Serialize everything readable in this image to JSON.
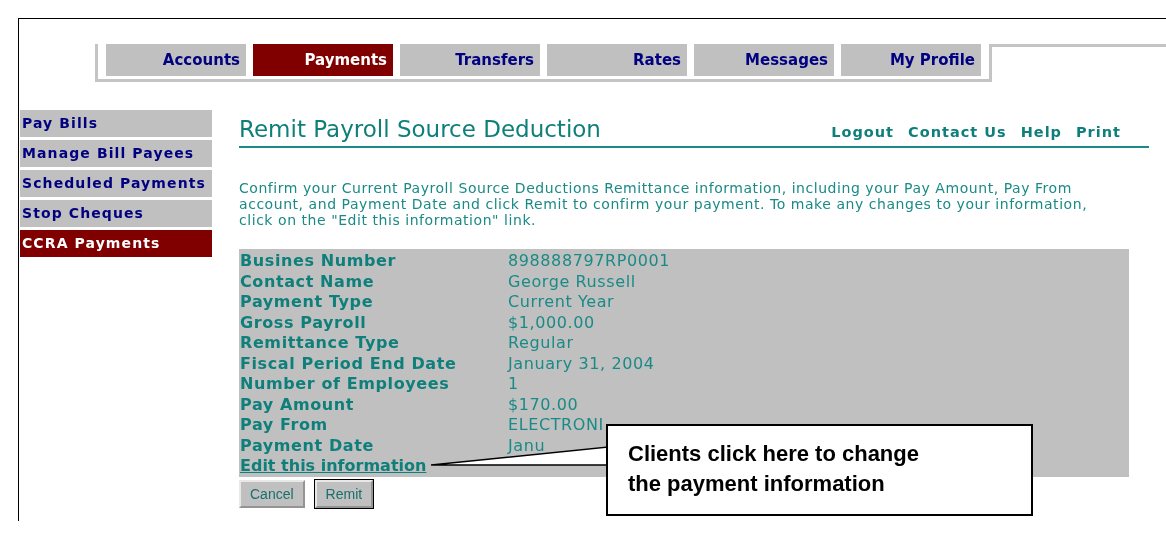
{
  "tabs": [
    {
      "label": "Accounts",
      "selected": false
    },
    {
      "label": "Payments",
      "selected": true
    },
    {
      "label": "Transfers",
      "selected": false
    },
    {
      "label": "Rates",
      "selected": false
    },
    {
      "label": "Messages",
      "selected": false
    },
    {
      "label": "My Profile",
      "selected": false
    }
  ],
  "sidebar": {
    "items": [
      {
        "label": "Pay Bills",
        "selected": false
      },
      {
        "label": "Manage Bill Payees",
        "selected": false
      },
      {
        "label": "Scheduled Payments",
        "selected": false
      },
      {
        "label": "Stop Cheques",
        "selected": false
      },
      {
        "label": "CCRA Payments",
        "selected": true
      }
    ]
  },
  "page_title": "Remit Payroll Source Deduction",
  "header_links": [
    "Logout",
    "Contact Us",
    "Help",
    "Print"
  ],
  "intro": "Confirm your Current Payroll Source Deductions Remittance information, including your Pay Amount, Pay From account, and Payment Date and click Remit to confirm your payment. To make any changes to your information, click on the \"Edit this information\" link.",
  "details": [
    {
      "label": "Busines Number",
      "value": "898888797RP0001"
    },
    {
      "label": "Contact Name",
      "value": "George Russell"
    },
    {
      "label": "Payment Type",
      "value": "Current Year"
    },
    {
      "label": "Gross Payroll",
      "value": "$1,000.00"
    },
    {
      "label": "Remittance Type",
      "value": "Regular"
    },
    {
      "label": "Fiscal Period End Date",
      "value": "January 31, 2004"
    },
    {
      "label": "Number of Employees",
      "value": "1"
    },
    {
      "label": "Pay Amount",
      "value": "$170.00"
    },
    {
      "label": "Pay From",
      "value": "ELECTRONI"
    },
    {
      "label": "Payment Date",
      "value": "Janu"
    }
  ],
  "edit_link": "Edit this information",
  "buttons": [
    {
      "label": "Cancel",
      "default": false
    },
    {
      "label": "Remit",
      "default": true
    }
  ],
  "callout": "Clients click here to change the payment information"
}
